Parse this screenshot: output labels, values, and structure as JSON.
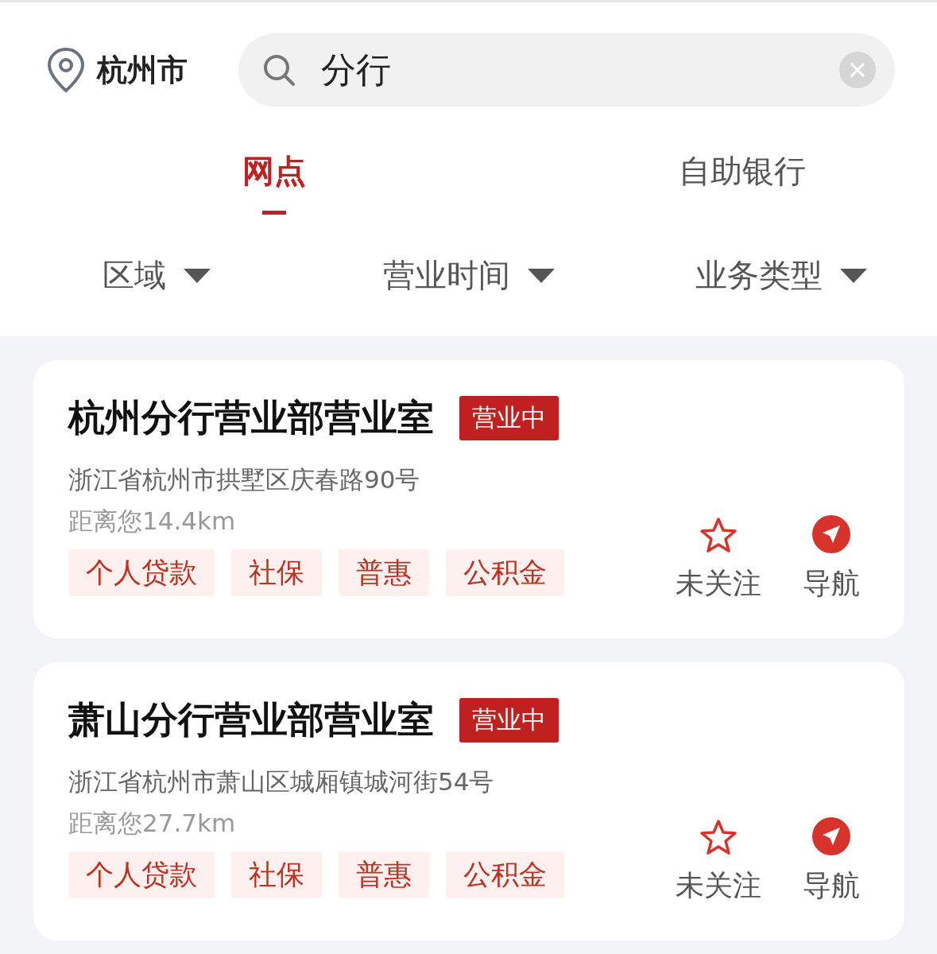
{
  "location": "杭州市",
  "search": {
    "value": "分行"
  },
  "tabs": [
    {
      "label": "网点",
      "selected": true
    },
    {
      "label": "自助银行",
      "selected": false
    }
  ],
  "filters": [
    "区域",
    "营业时间",
    "业务类型"
  ],
  "branches": [
    {
      "name": "杭州分行营业部营业室",
      "status": "营业中",
      "address": "浙江省杭州市拱墅区庆春路90号",
      "distance": "距离您14.4km",
      "tags": [
        "个人贷款",
        "社保",
        "普惠",
        "公积金"
      ],
      "follow_label": "未关注",
      "followed": false,
      "nav_label": "导航"
    },
    {
      "name": "萧山分行营业部营业室",
      "status": "营业中",
      "address": "浙江省杭州市萧山区城厢镇城河街54号",
      "distance": "距离您27.7km",
      "tags": [
        "个人贷款",
        "社保",
        "普惠",
        "公积金"
      ],
      "follow_label": "未关注",
      "followed": false,
      "nav_label": "导航"
    }
  ]
}
